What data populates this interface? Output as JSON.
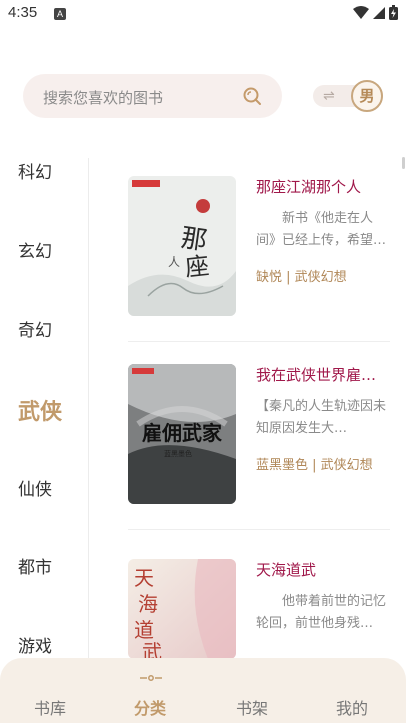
{
  "status_bar": {
    "time": "4:35",
    "notif_badge": "A"
  },
  "search": {
    "placeholder": "搜索您喜欢的图书"
  },
  "gender_toggle": {
    "label": "男"
  },
  "categories": [
    "科幻",
    "玄幻",
    "奇幻",
    "武侠",
    "仙侠",
    "都市",
    "游戏"
  ],
  "active_category": "武侠",
  "books": [
    {
      "title": "那座江湖那个人",
      "description": "新书《他走在人间》已经上传，希望…",
      "author": "缺悦",
      "genre": "武侠幻想",
      "cover_text": "那座江湖那个人"
    },
    {
      "title": "我在武侠世界雇…",
      "description": "【秦凡的人生轨迹因未知原因发生大…",
      "author": "蓝黑墨色",
      "genre": "武侠幻想",
      "cover_text": "雇佣武家"
    },
    {
      "title": "天海道武",
      "description": "他带着前世的记忆轮回，前世他身残…",
      "author": "",
      "genre": "",
      "cover_text": "天海道武"
    }
  ],
  "bottom_nav": [
    "书库",
    "分类",
    "书架",
    "我的"
  ],
  "colors": {
    "accent": "#c19a6b",
    "title": "#a0184a",
    "meta": "#b08757"
  }
}
